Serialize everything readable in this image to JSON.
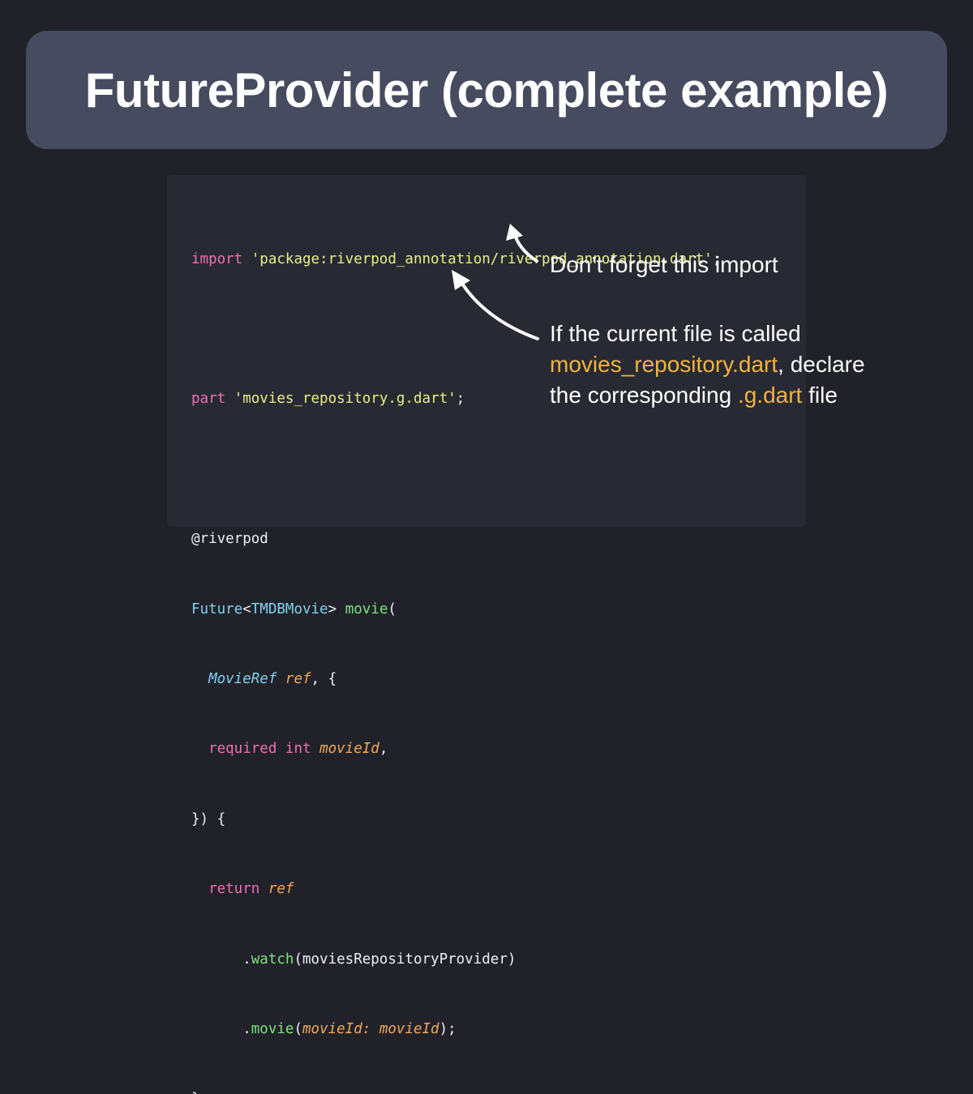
{
  "title": "FutureProvider (complete example)",
  "code": {
    "import_kw": "import",
    "import_str": "'package:riverpod_annotation/riverpod_annotation.dart'",
    "semi": ";",
    "part_kw": "part",
    "part_str": "'movies_repository.g.dart'",
    "annotation": "@riverpod",
    "future_type": "Future",
    "lt": "<",
    "movie_type": "TMDBMovie",
    "gt": ">",
    "fn_name": "movie",
    "open_paren": "(",
    "ref_type": "MovieRef",
    "ref_param": "ref",
    "comma_brace": ", {",
    "required_kw": "required",
    "int_kw": "int",
    "movieid_param": "movieId",
    "comma": ",",
    "close_sig": "}) {",
    "return_kw": "return",
    "return_ref": "ref",
    "dot": ".",
    "watch_fn": "watch",
    "watch_arg": "(moviesRepositoryProvider)",
    "movie_fn": "movie",
    "named_arg_label": "movieId:",
    "named_arg_value": "movieId",
    "close_call": ");",
    "close_brace": "}"
  },
  "notes": {
    "import_note": "Don’t forget this import",
    "part_note_line1": "If the current file is called",
    "part_note_file": "movies_repository.dart",
    "part_note_after": ", declare",
    "part_note_line3_pre": "the corresponding ",
    "part_note_ext": ".g.dart",
    "part_note_line3_post": " file"
  },
  "colors": {
    "background": "#212229",
    "title_bar": "#474b5f",
    "code_panel": "#282a33",
    "keyword": "#f06fb4",
    "string": "#e7ef86",
    "type": "#7ed3f2",
    "function": "#7be37d",
    "param": "#f3a85a",
    "highlight": "#f3b33d"
  }
}
